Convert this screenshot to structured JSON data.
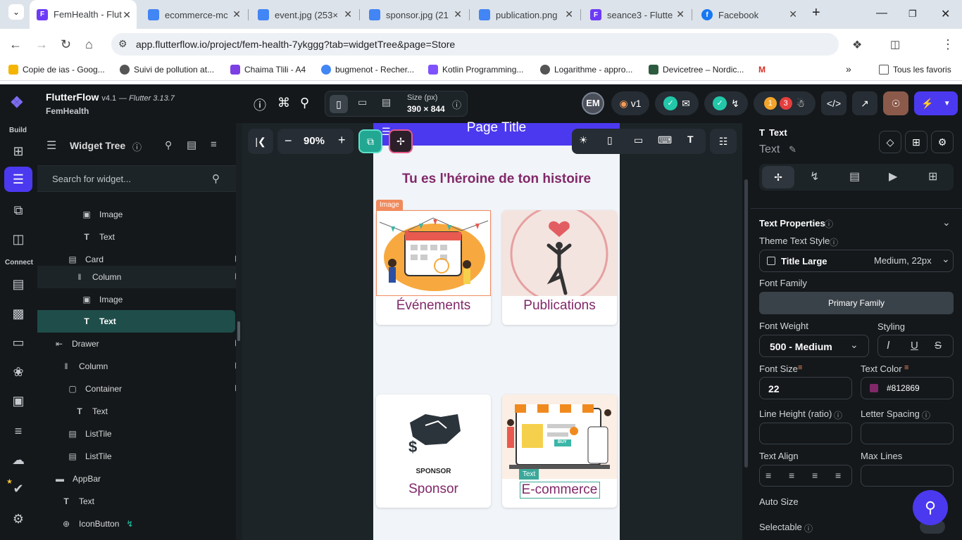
{
  "browser": {
    "tabs": [
      {
        "title": "FemHealth - Flut",
        "active": true,
        "color": "#6d3bf6"
      },
      {
        "title": "ecommerce-mc",
        "active": false,
        "color": "#4285f4"
      },
      {
        "title": "event.jpg (253×",
        "active": false,
        "color": "#4285f4"
      },
      {
        "title": "sponsor.jpg (21",
        "active": false,
        "color": "#4285f4"
      },
      {
        "title": "publication.png",
        "active": false,
        "color": "#4285f4"
      },
      {
        "title": "seance3 - Flutte",
        "active": false,
        "color": "#6d3bf6"
      },
      {
        "title": "Facebook",
        "active": false,
        "color": "#1877f2"
      }
    ],
    "url": "app.flutterflow.io/project/fem-health-7ykggg?tab=widgetTree&page=Store",
    "bookmarks": [
      {
        "label": "Copie de ias - Goog...",
        "color": "#f4b400"
      },
      {
        "label": "Suivi de pollution at...",
        "color": "#555555"
      },
      {
        "label": "Chaima Tlili - A4",
        "color": "#7b3fe4"
      },
      {
        "label": "bugmenot - Recher...",
        "color": "#4285f4"
      },
      {
        "label": "Kotlin Programming...",
        "color": "#7f52ff"
      },
      {
        "label": "Logarithme - appro...",
        "color": "#555555"
      },
      {
        "label": "Devicetree – Nordic...",
        "color": "#2d5b3f"
      }
    ],
    "bookmarks_all": "Tous les favoris"
  },
  "ff": {
    "brand": "FlutterFlow",
    "version": "v4.1",
    "flutter": "— Flutter 3.13.7",
    "project": "FemHealth",
    "size_label": "Size (px)",
    "size_value": "390 × 844",
    "avatar": "EM",
    "version_badge": "v1",
    "issues_a": "1",
    "issues_b": "3",
    "rail_build": "Build",
    "rail_connect": "Connect",
    "zoom": "90%"
  },
  "tree": {
    "title": "Widget Tree",
    "search_placeholder": "Search for widget...",
    "rows": [
      {
        "label": "Image",
        "icon": "image-icon"
      },
      {
        "label": "Text",
        "icon": "text-icon"
      },
      {
        "label": "Card",
        "icon": "card-icon"
      },
      {
        "label": "Column",
        "icon": "column-icon"
      },
      {
        "label": "Image",
        "icon": "image-icon"
      },
      {
        "label": "Text",
        "icon": "text-icon"
      },
      {
        "label": "Drawer",
        "icon": "drawer-icon"
      },
      {
        "label": "Column",
        "icon": "column-icon"
      },
      {
        "label": "Container",
        "icon": "container-icon"
      },
      {
        "label": "Text",
        "icon": "text-icon"
      },
      {
        "label": "ListTile",
        "icon": "listtile-icon"
      },
      {
        "label": "ListTile",
        "icon": "listtile-icon"
      },
      {
        "label": "AppBar",
        "icon": "appbar-icon"
      },
      {
        "label": "Text",
        "icon": "text-icon"
      },
      {
        "label": "IconButton",
        "icon": "iconbutton-icon"
      }
    ]
  },
  "phone": {
    "app_bar_title": "Page Title",
    "heading": "Tu es l'héroine de ton histoire",
    "image_tag": "Image",
    "text_tag": "Text",
    "sponsor_caption": "SPONSOR",
    "buy_label": "BUY",
    "cards": [
      {
        "label": "Événements"
      },
      {
        "label": "Publications"
      },
      {
        "label": "Sponsor"
      },
      {
        "label": "E-commerce"
      }
    ]
  },
  "props": {
    "widget_title": "Text",
    "widget_name": "Text",
    "section": "Text Properties",
    "theme_style_label": "Theme Text Style",
    "theme_style_value": "Title Large",
    "theme_style_meta": "Medium, 22px",
    "font_family_label": "Font Family",
    "font_family_value": "Primary Family",
    "font_weight_label": "Font Weight",
    "font_weight_value": "500 - Medium",
    "styling_label": "Styling",
    "font_size_label": "Font Size",
    "font_size_value": "22",
    "text_color_label": "Text Color",
    "text_color_value": "#812869",
    "line_height_label": "Line Height (ratio)",
    "letter_spacing_label": "Letter Spacing",
    "text_align_label": "Text Align",
    "max_lines_label": "Max Lines",
    "auto_size_label": "Auto Size",
    "selectable_label": "Selectable"
  },
  "colors": {
    "accent": "#4b39ef",
    "brand_text": "#812869",
    "selected_row": "#1f4d4a",
    "ff_dark": "#14181b"
  }
}
